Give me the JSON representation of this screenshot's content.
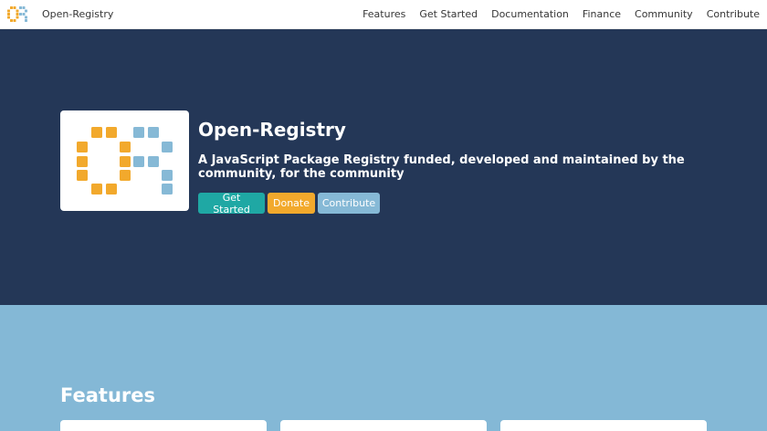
{
  "navbar": {
    "brand_name": "Open-Registry",
    "links": [
      {
        "label": "Features"
      },
      {
        "label": "Get Started"
      },
      {
        "label": "Documentation"
      },
      {
        "label": "Finance"
      },
      {
        "label": "Community"
      },
      {
        "label": "Contribute"
      }
    ]
  },
  "hero": {
    "title": "Open-Registry",
    "subtitle": "A JavaScript Package Registry funded, developed and maintained by the community, for the community",
    "buttons": {
      "get_started": "Get Started",
      "donate": "Donate",
      "contribute": "Contribute"
    }
  },
  "features": {
    "title": "Features"
  },
  "colors": {
    "hero_bg": "#243757",
    "features_bg": "#84b8d6",
    "logo_orange": "#f2a92c",
    "logo_blue": "#86b9d6",
    "button_teal": "#1fa8a4",
    "button_orange": "#f2a92c",
    "button_blue": "#86b9d6"
  }
}
